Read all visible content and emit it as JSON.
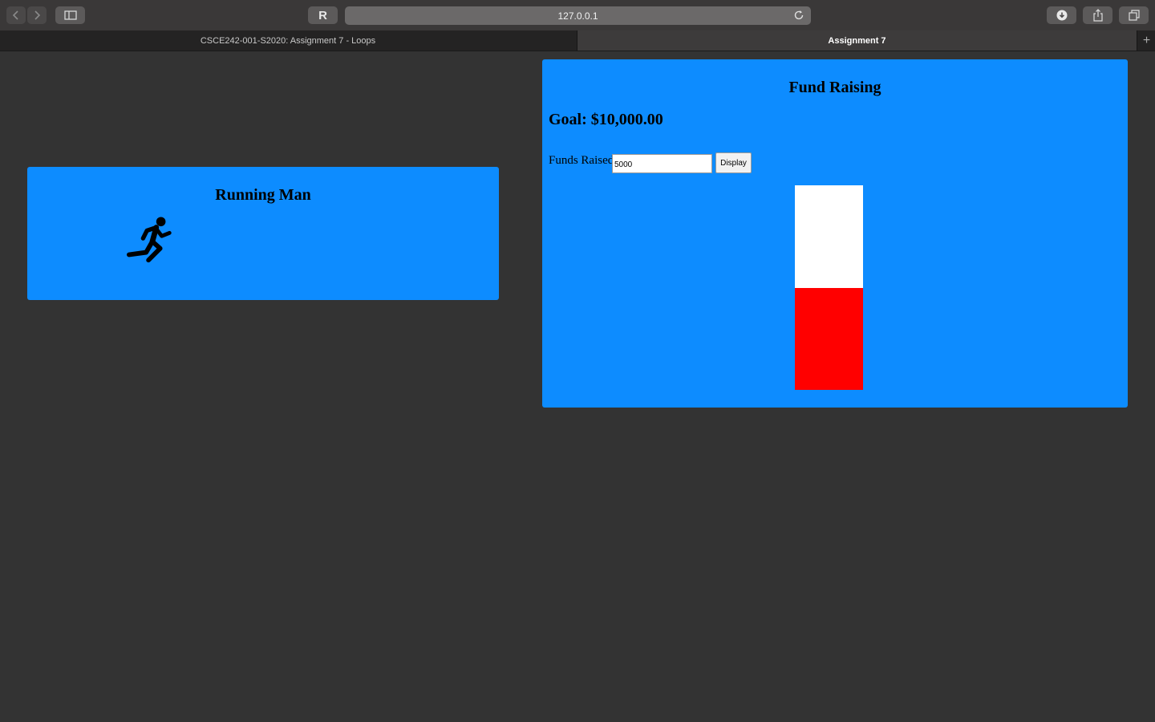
{
  "browser": {
    "address": "127.0.0.1",
    "reader_label": "R",
    "tabs": [
      {
        "label": "CSCE242-001-S2020: Assignment 7 - Loops",
        "active": false
      },
      {
        "label": "Assignment 7",
        "active": true
      }
    ],
    "new_tab_label": "+"
  },
  "running_man": {
    "title": "Running Man",
    "icon": "running-man-icon"
  },
  "fund_raising": {
    "title": "Fund Raising",
    "goal_text": "Goal: $10,000.00",
    "funds_label": "Funds Raised:",
    "funds_value": "5000",
    "display_label": "Display",
    "progress_fraction": 0.5,
    "fill_color": "#ff0000",
    "empty_color": "#ffffff"
  },
  "colors": {
    "card": "#0d8cff",
    "background": "#333333"
  }
}
